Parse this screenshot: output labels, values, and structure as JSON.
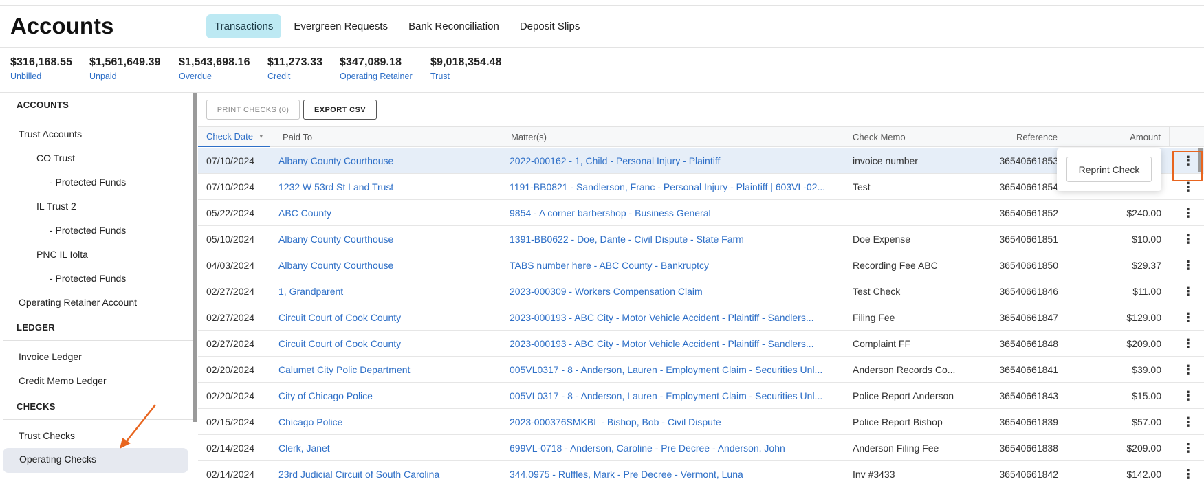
{
  "header": {
    "title": "Accounts",
    "tabs": [
      {
        "label": "Transactions",
        "active": true
      },
      {
        "label": "Evergreen Requests",
        "active": false
      },
      {
        "label": "Bank Reconciliation",
        "active": false
      },
      {
        "label": "Deposit Slips",
        "active": false
      }
    ]
  },
  "summary": [
    {
      "amount": "$316,168.55",
      "label": "Unbilled"
    },
    {
      "amount": "$1,561,649.39",
      "label": "Unpaid"
    },
    {
      "amount": "$1,543,698.16",
      "label": "Overdue"
    },
    {
      "amount": "$11,273.33",
      "label": "Credit"
    },
    {
      "amount": "$347,089.18",
      "label": "Operating Retainer"
    },
    {
      "amount": "$9,018,354.48",
      "label": "Trust"
    }
  ],
  "sidebar": {
    "sections": [
      {
        "heading": "ACCOUNTS"
      },
      {
        "heading": "LEDGER"
      },
      {
        "heading": "CHECKS"
      }
    ],
    "items": [
      {
        "label": "Trust Accounts"
      },
      {
        "label": "CO Trust"
      },
      {
        "label": "- Protected Funds"
      },
      {
        "label": "IL Trust 2"
      },
      {
        "label": "- Protected Funds"
      },
      {
        "label": "PNC IL Iolta"
      },
      {
        "label": "- Protected Funds"
      },
      {
        "label": "Operating Retainer Account"
      },
      {
        "label": "Invoice Ledger"
      },
      {
        "label": "Credit Memo Ledger"
      },
      {
        "label": "Trust Checks"
      },
      {
        "label": "Operating Checks"
      }
    ]
  },
  "toolbar": {
    "print_label": "PRINT CHECKS (0)",
    "export_label": "EXPORT CSV"
  },
  "table": {
    "columns": [
      "Check Date",
      "Paid To",
      "Matter(s)",
      "Check Memo",
      "Reference",
      "Amount"
    ],
    "rows": [
      {
        "date": "07/10/2024",
        "paid_to": "Albany County Courthouse",
        "matter": "2022-000162 - 1, Child - Personal Injury - Plaintiff",
        "memo": "invoice number",
        "reference": "36540661853",
        "amount": ""
      },
      {
        "date": "07/10/2024",
        "paid_to": "1232 W 53rd St Land Trust",
        "matter": "1191-BB0821 - Sandlerson, Franc - Personal Injury - Plaintiff | 603VL-02...",
        "memo": "Test",
        "reference": "36540661854",
        "amount": ""
      },
      {
        "date": "05/22/2024",
        "paid_to": "ABC County",
        "matter": "9854 - A corner barbershop - Business General",
        "memo": "",
        "reference": "36540661852",
        "amount": "$240.00"
      },
      {
        "date": "05/10/2024",
        "paid_to": "Albany County Courthouse",
        "matter": "1391-BB0622 - Doe, Dante - Civil Dispute - State Farm",
        "memo": "Doe Expense",
        "reference": "36540661851",
        "amount": "$10.00"
      },
      {
        "date": "04/03/2024",
        "paid_to": "Albany County Courthouse",
        "matter": "TABS number here - ABC County - Bankruptcy",
        "memo": "Recording Fee ABC",
        "reference": "36540661850",
        "amount": "$29.37"
      },
      {
        "date": "02/27/2024",
        "paid_to": "1, Grandparent",
        "matter": "2023-000309 - Workers Compensation Claim",
        "memo": "Test Check",
        "reference": "36540661846",
        "amount": "$11.00"
      },
      {
        "date": "02/27/2024",
        "paid_to": "Circuit Court of Cook County",
        "matter": "2023-000193 - ABC City - Motor Vehicle Accident - Plaintiff - Sandlers...",
        "memo": "Filing Fee",
        "reference": "36540661847",
        "amount": "$129.00"
      },
      {
        "date": "02/27/2024",
        "paid_to": "Circuit Court of Cook County",
        "matter": "2023-000193 - ABC City - Motor Vehicle Accident - Plaintiff - Sandlers...",
        "memo": "Complaint FF",
        "reference": "36540661848",
        "amount": "$209.00"
      },
      {
        "date": "02/20/2024",
        "paid_to": "Calumet City Polic Department",
        "matter": "005VL0317 - 8 - Anderson, Lauren - Employment Claim - Securities Unl...",
        "memo": "Anderson Records Co...",
        "reference": "36540661841",
        "amount": "$39.00"
      },
      {
        "date": "02/20/2024",
        "paid_to": "City of Chicago Police",
        "matter": "005VL0317 - 8 - Anderson, Lauren - Employment Claim - Securities Unl...",
        "memo": "Police Report Anderson",
        "reference": "36540661843",
        "amount": "$15.00"
      },
      {
        "date": "02/15/2024",
        "paid_to": "Chicago Police",
        "matter": "2023-000376SMKBL - Bishop, Bob - Civil Dispute",
        "memo": "Police Report Bishop",
        "reference": "36540661839",
        "amount": "$57.00"
      },
      {
        "date": "02/14/2024",
        "paid_to": "Clerk, Janet",
        "matter": "699VL-0718 - Anderson, Caroline - Pre Decree - Anderson, John",
        "memo": "Anderson Filing Fee",
        "reference": "36540661838",
        "amount": "$209.00"
      },
      {
        "date": "02/14/2024",
        "paid_to": "23rd Judicial Circuit of South Carolina",
        "matter": "344.0975 - Ruffles, Mark - Pre Decree - Vermont, Luna",
        "memo": "Inv #3433",
        "reference": "36540661842",
        "amount": "$142.00"
      }
    ]
  },
  "popover": {
    "reprint_label": "Reprint Check"
  },
  "colors": {
    "accent": "#2e6fc7",
    "active_tab": "#bde9f3",
    "highlight_row": "#e6eef8",
    "callout": "#e8651f"
  }
}
